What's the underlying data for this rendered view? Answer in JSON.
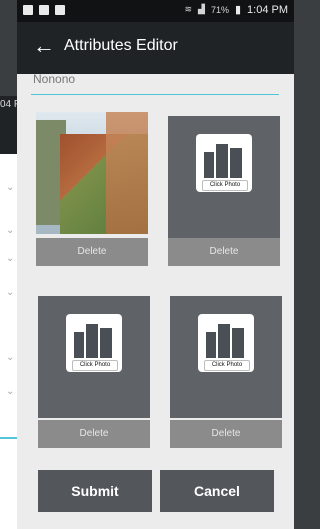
{
  "status_bar": {
    "time": "1:04 PM",
    "battery": "71%"
  },
  "background_snippet": {
    "time_fragment": "04 P"
  },
  "app_bar": {
    "title": "Attributes Editor"
  },
  "dialog": {
    "name_value": "Nonono",
    "tiles": [
      {
        "type": "photo",
        "delete_label": "Delete"
      },
      {
        "type": "placeholder",
        "click_label": "Click Photo",
        "delete_label": "Delete"
      },
      {
        "type": "placeholder",
        "click_label": "Click Photo",
        "delete_label": "Delete"
      },
      {
        "type": "placeholder",
        "click_label": "Click Photo",
        "delete_label": "Delete"
      }
    ],
    "buttons": {
      "submit": "Submit",
      "cancel": "Cancel"
    }
  },
  "icons": [
    "back-arrow-icon",
    "building-icon",
    "wifi-icon",
    "signal-icon",
    "battery-icon",
    "notification-icon",
    "chevron-down-icon"
  ],
  "colors": {
    "app_bar_bg": "#1f2326",
    "accent": "#52c6d8",
    "tile_bg": "#5f6266",
    "button_bg": "#53575b",
    "delete_bg": "#8b8b8b"
  }
}
